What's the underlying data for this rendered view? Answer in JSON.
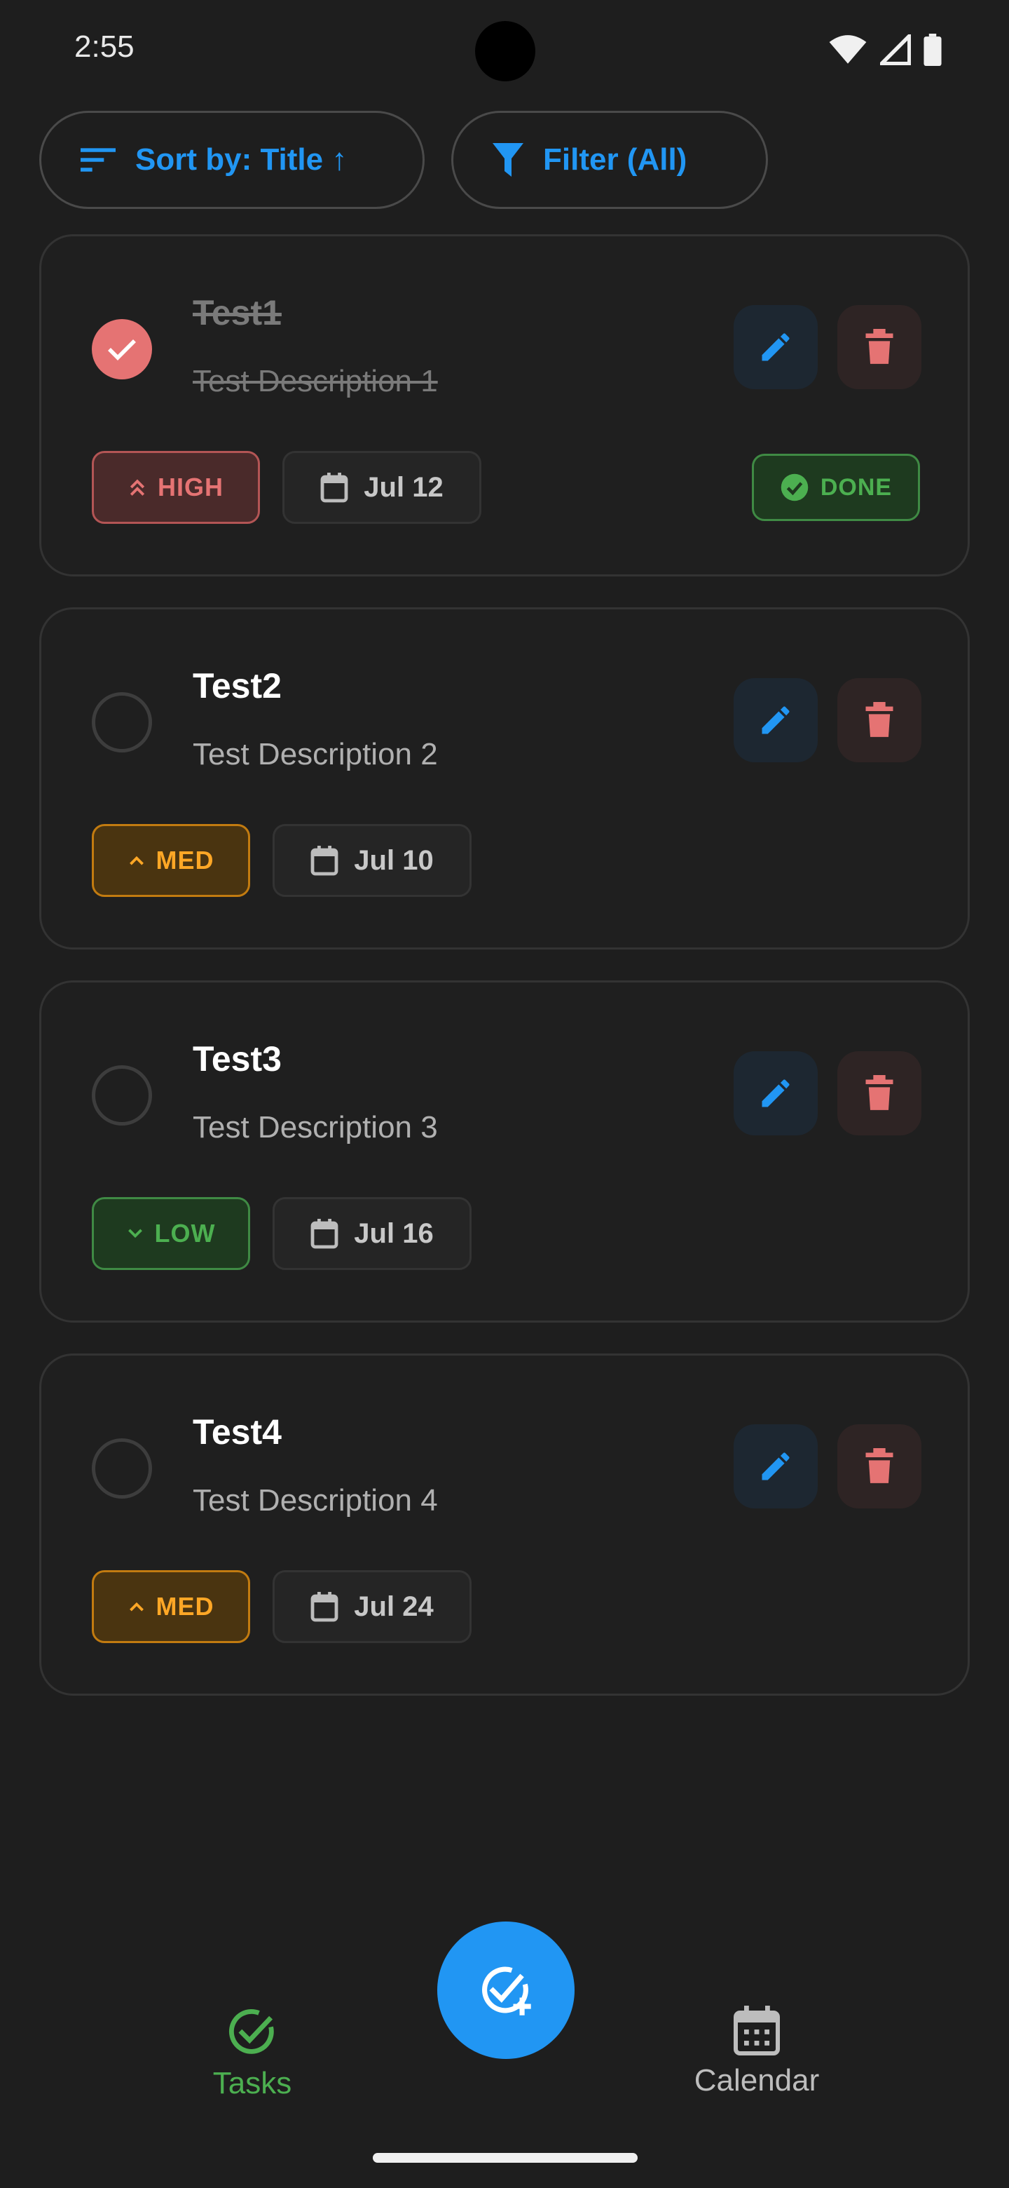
{
  "status_bar": {
    "time": "2:55"
  },
  "toolbar": {
    "sort_label": "Sort by: Title ↑",
    "filter_label": "Filter (All)"
  },
  "tasks": [
    {
      "title": "Test1",
      "description": "Test Description 1",
      "priority": "HIGH",
      "date": "Jul 12",
      "completed": true,
      "status": "DONE"
    },
    {
      "title": "Test2",
      "description": "Test Description 2",
      "priority": "MED",
      "date": "Jul 10",
      "completed": false
    },
    {
      "title": "Test3",
      "description": "Test Description 3",
      "priority": "LOW",
      "date": "Jul 16",
      "completed": false
    },
    {
      "title": "Test4",
      "description": "Test Description 4",
      "priority": "MED",
      "date": "Jul 24",
      "completed": false
    }
  ],
  "bottom_nav": {
    "tasks_label": "Tasks",
    "calendar_label": "Calendar",
    "active": "Tasks"
  },
  "icons": {
    "sort": "sort-icon",
    "filter": "filter-icon",
    "edit": "pencil-icon",
    "delete": "trash-icon",
    "date": "calendar-icon",
    "done": "check-circle-icon",
    "fab": "add-task-icon"
  },
  "colors": {
    "accent": "#2196f3",
    "high": "#e57373",
    "med": "#ffa726",
    "low": "#4caf50",
    "background": "#1e1e1e"
  }
}
